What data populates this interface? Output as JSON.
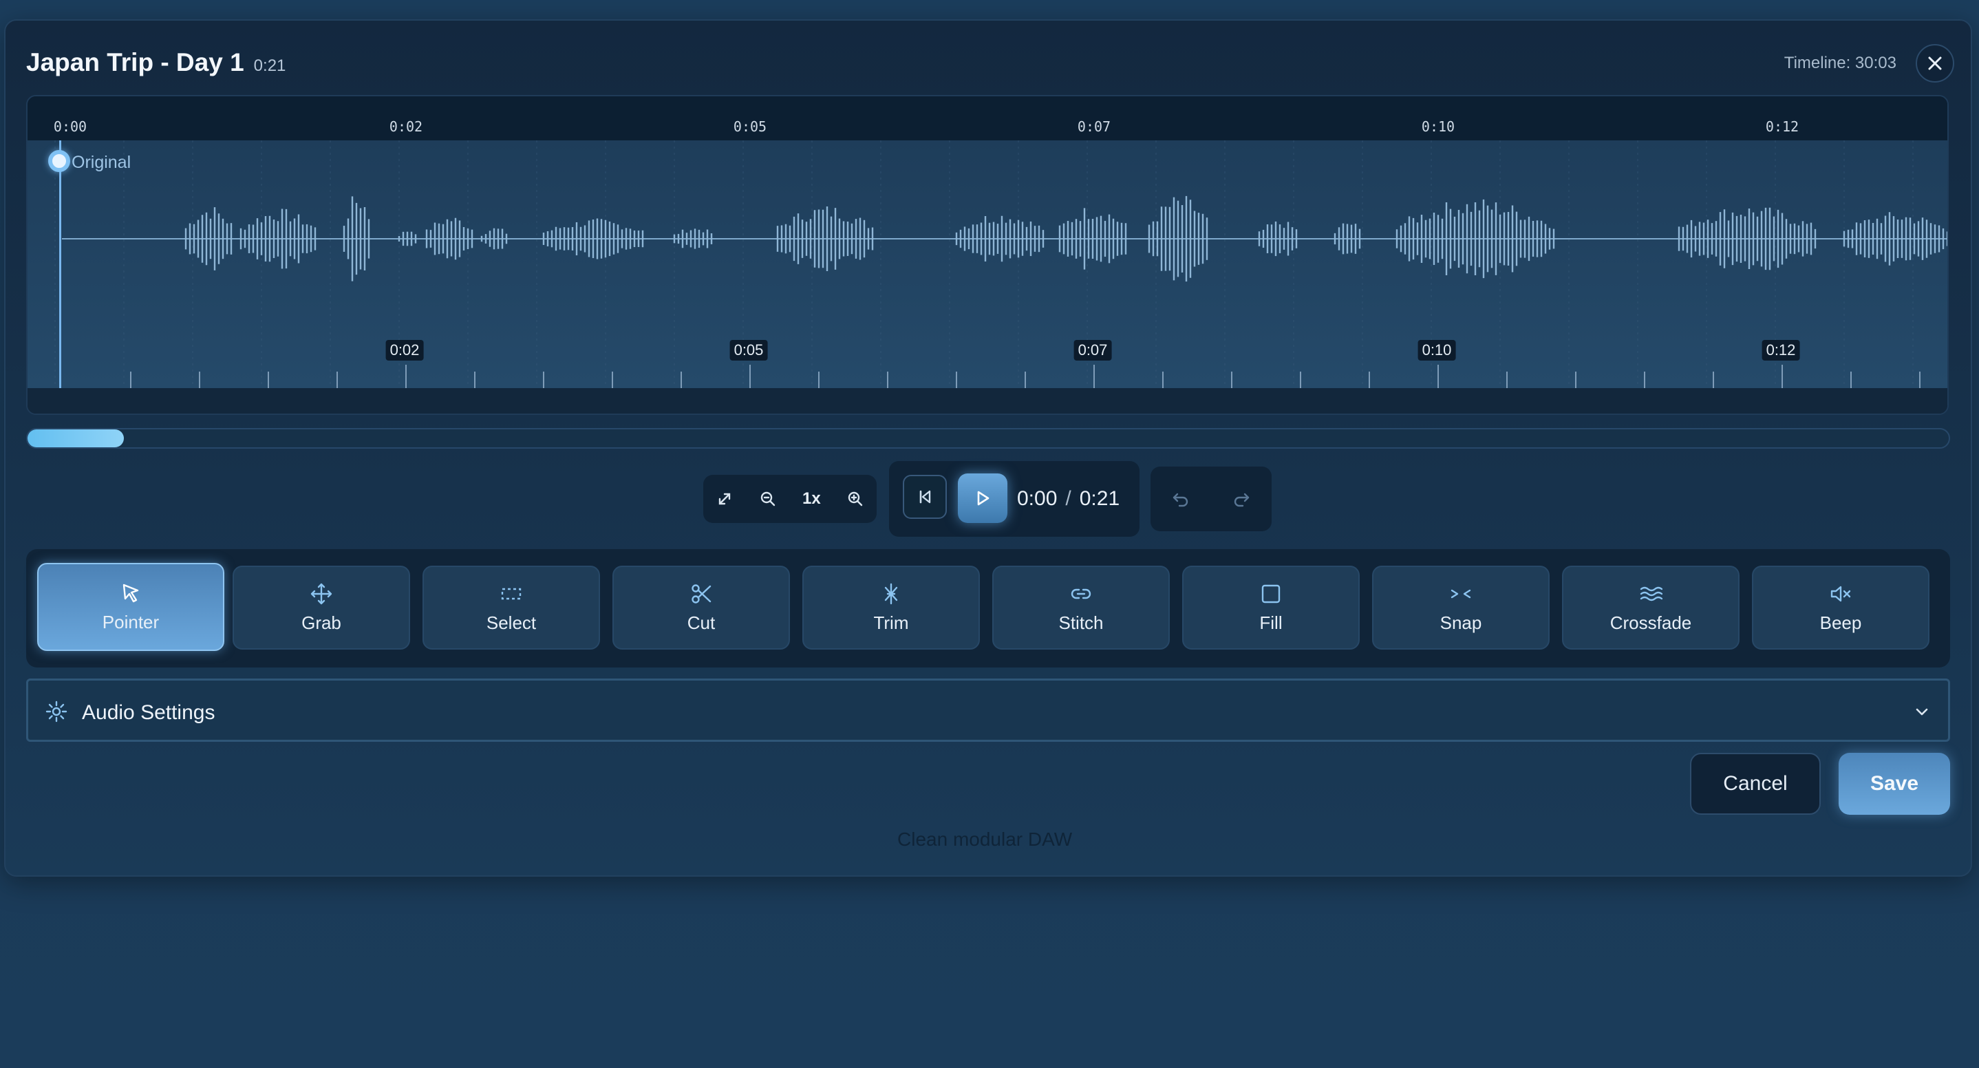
{
  "header": {
    "title": "Japan Trip - Day 1",
    "duration": "0:21",
    "timeline_label": "Timeline: 30:03"
  },
  "waveform": {
    "ruler_labels": [
      "0:00",
      "0:02",
      "0:05",
      "0:07",
      "0:10",
      "0:12"
    ],
    "track_label": "Original",
    "marker_labels": [
      "0:02",
      "0:05",
      "0:07",
      "0:10",
      "0:12"
    ]
  },
  "scrollbar": {
    "position_fraction": 0.05
  },
  "zoom": {
    "level": "1x"
  },
  "transport": {
    "current_time": "0:00",
    "separator": "/",
    "total_time": "0:21"
  },
  "tools": [
    {
      "label": "Pointer",
      "icon": "pointer-icon",
      "active": true
    },
    {
      "label": "Grab",
      "icon": "move-icon"
    },
    {
      "label": "Select",
      "icon": "select-icon"
    },
    {
      "label": "Cut",
      "icon": "scissors-icon"
    },
    {
      "label": "Trim",
      "icon": "trim-icon"
    },
    {
      "label": "Stitch",
      "icon": "link-icon"
    },
    {
      "label": "Fill",
      "icon": "square-icon"
    },
    {
      "label": "Snap",
      "icon": "snap-icon"
    },
    {
      "label": "Crossfade",
      "icon": "waves-icon"
    },
    {
      "label": "Beep",
      "icon": "mute-icon"
    }
  ],
  "settings": {
    "title": "Audio Settings"
  },
  "actions": {
    "cancel": "Cancel",
    "save": "Save"
  },
  "footer": {
    "note": "Clean modular DAW"
  },
  "colors": {
    "accent": "#6aa7dc",
    "waveform": "#8fb6d6",
    "background": "#1a3a58"
  }
}
